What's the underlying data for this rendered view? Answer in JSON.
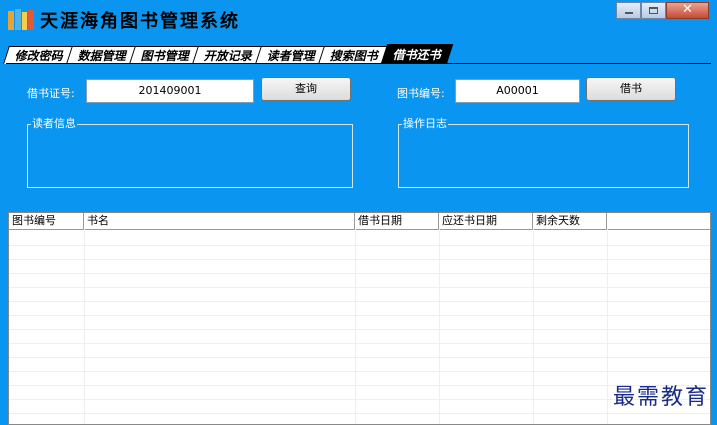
{
  "window": {
    "title": "天涯海角图书管理系统",
    "buttons": {
      "minimize": "minimize",
      "maximize": "maximize",
      "close": "✕"
    }
  },
  "tabs": [
    {
      "label": "修改密码",
      "active": false
    },
    {
      "label": "数据管理",
      "active": false
    },
    {
      "label": "图书管理",
      "active": false
    },
    {
      "label": "开放记录",
      "active": false
    },
    {
      "label": "读者管理",
      "active": false
    },
    {
      "label": "搜索图书",
      "active": false
    },
    {
      "label": "借书还书",
      "active": true
    }
  ],
  "borrow": {
    "card_label": "借书证号:",
    "card_value": "201409001",
    "query_button": "查询",
    "book_label": "图书编号:",
    "book_value": "A00001",
    "borrow_button": "借书",
    "reader_group": "读者信息",
    "log_group": "操作日志"
  },
  "table": {
    "columns": [
      "图书编号",
      "书名",
      "借书日期",
      "应还书日期",
      "剩余天数"
    ],
    "rows": []
  },
  "watermark": "最需教育",
  "colors": {
    "background": "#0a96f0",
    "active_tab": "#000000"
  }
}
